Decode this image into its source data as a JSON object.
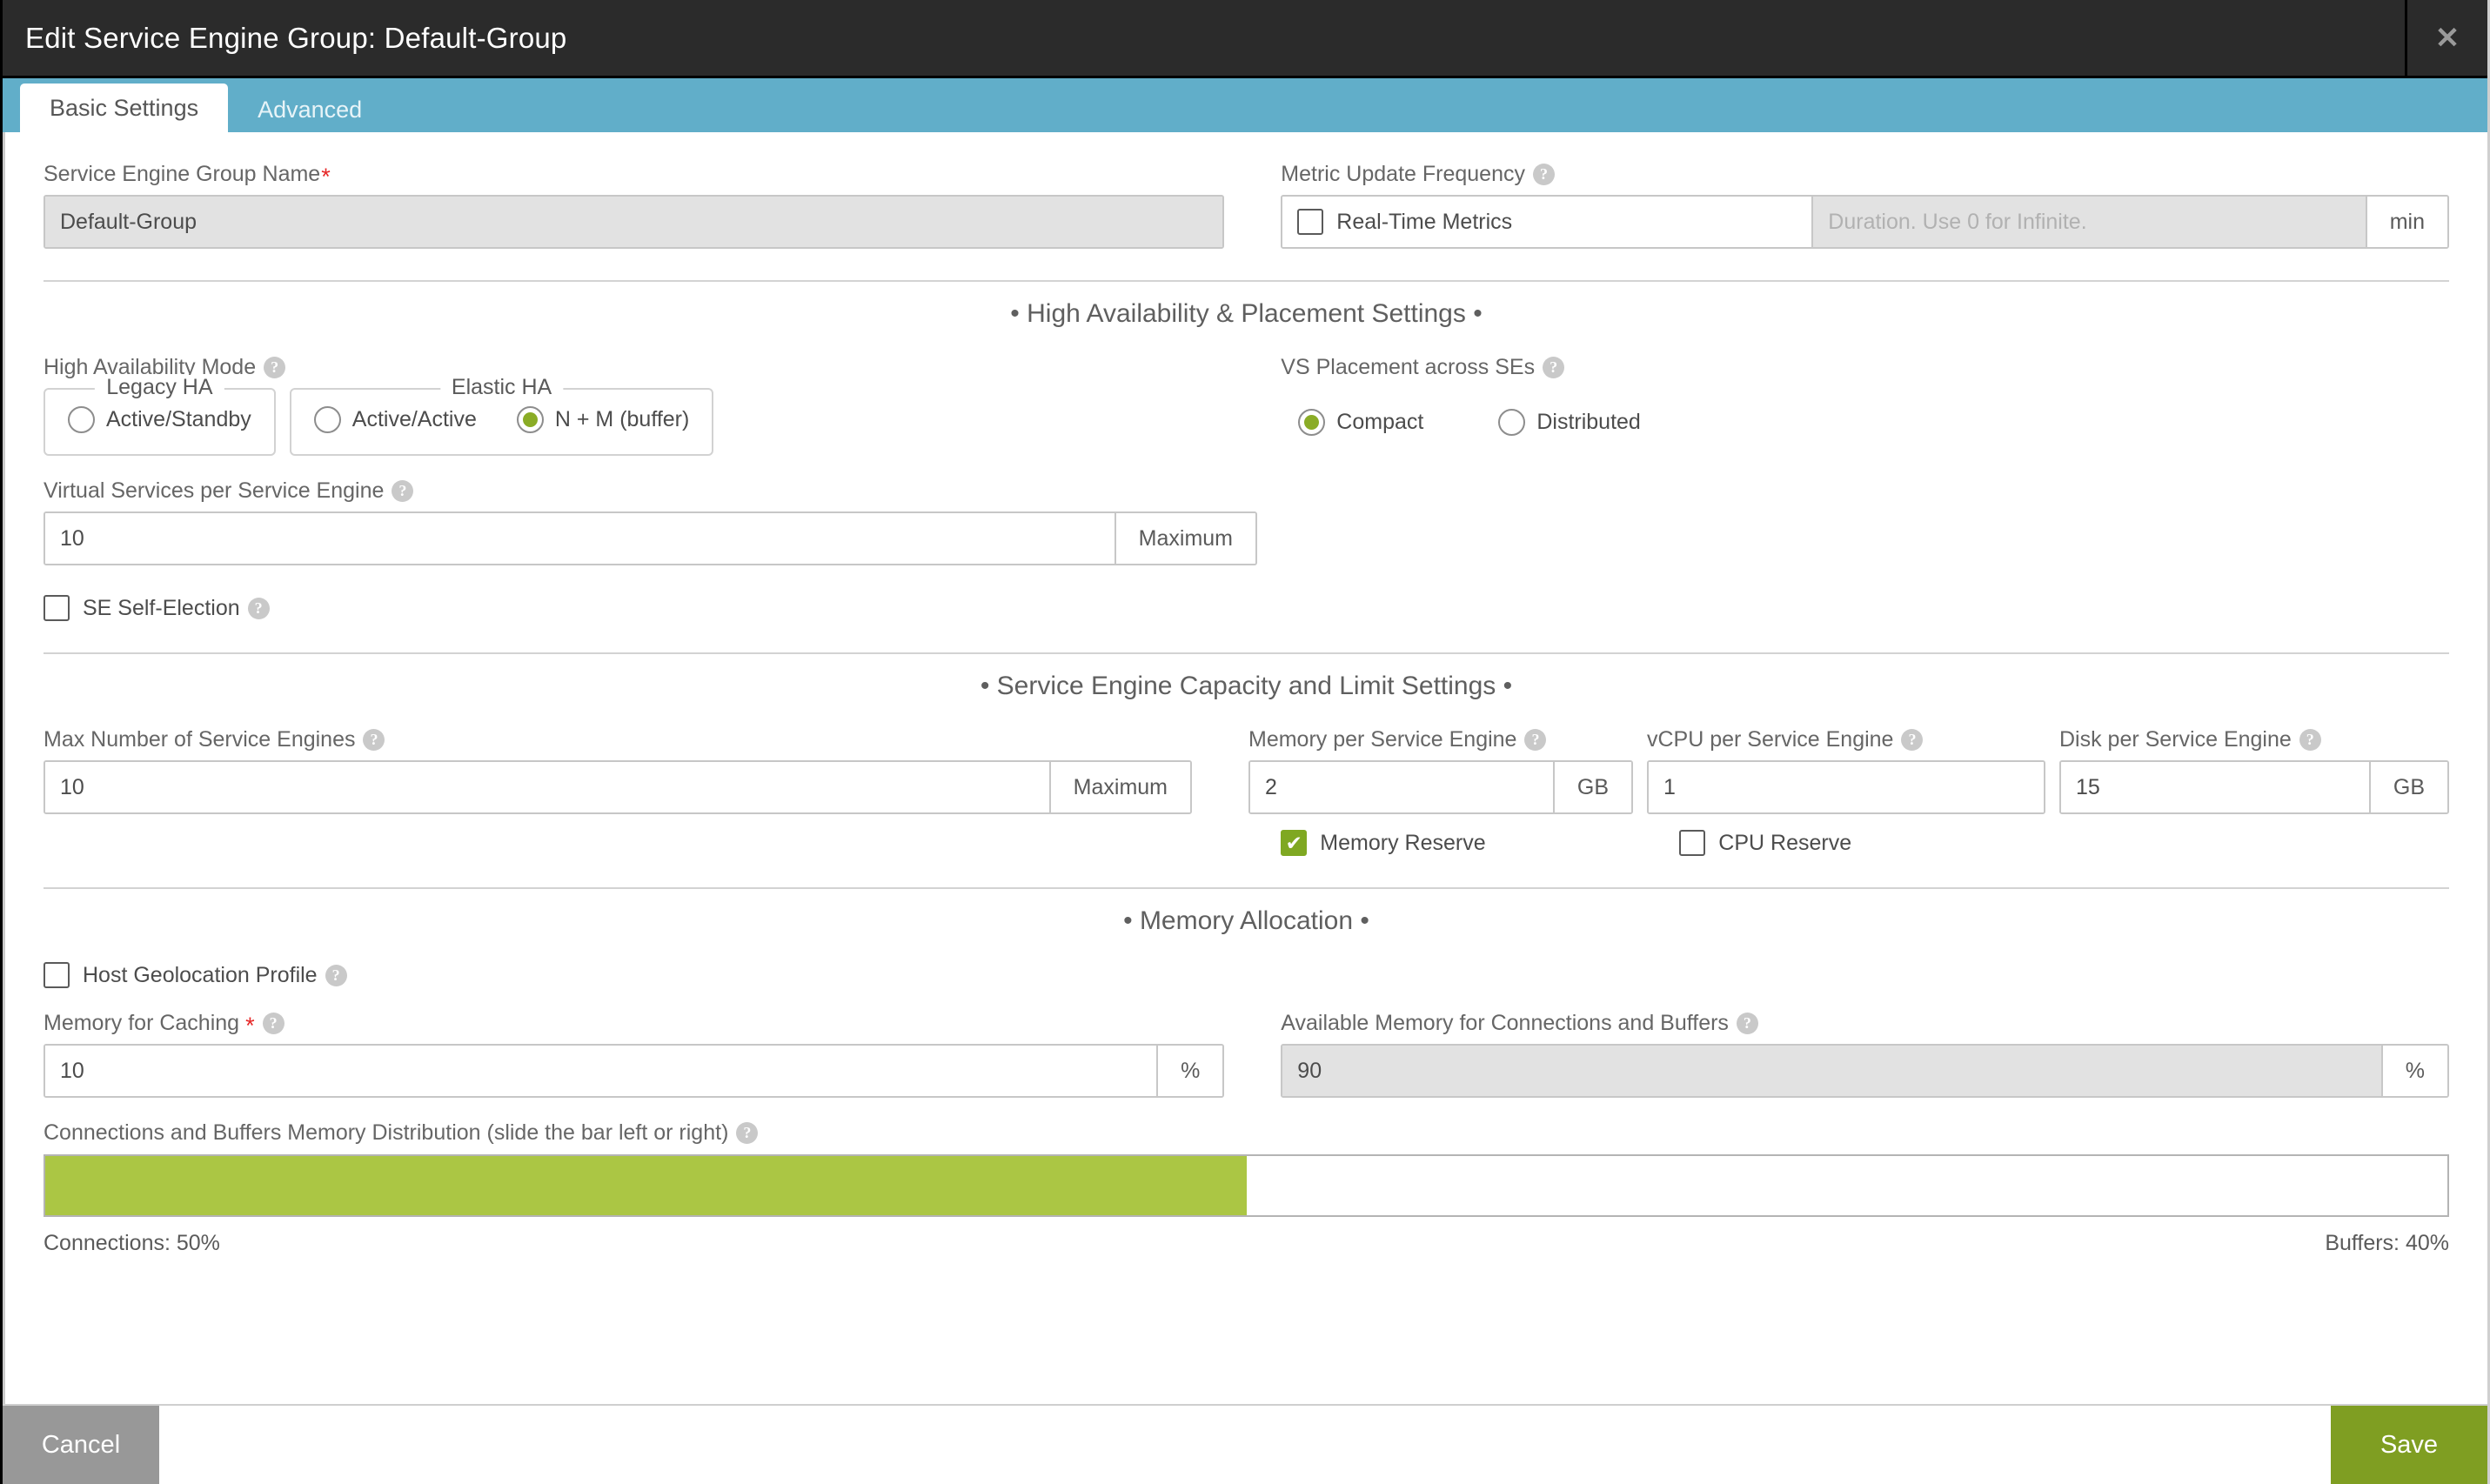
{
  "window": {
    "title": "Edit Service Engine Group: Default-Group",
    "close_icon": "close-icon"
  },
  "tabs": [
    {
      "label": "Basic Settings",
      "active": true
    },
    {
      "label": "Advanced",
      "active": false
    }
  ],
  "form": {
    "se_group_name": {
      "label": "Service Engine Group Name",
      "required": true,
      "value": "Default-Group",
      "disabled": true
    },
    "metric_update_frequency": {
      "label": "Metric Update Frequency",
      "help": "?",
      "realtime_checkbox_label": "Real-Time Metrics",
      "realtime_checked": false,
      "duration_placeholder": "Duration. Use 0 for Infinite.",
      "duration_value": "",
      "unit": "min"
    },
    "sections": {
      "ha_placement": "High Availability & Placement Settings",
      "capacity": "Service Engine Capacity and Limit Settings",
      "memory": "Memory Allocation"
    },
    "high_availability_mode": {
      "label": "High Availability Mode",
      "help": "?",
      "groups": [
        {
          "legend": "Legacy HA",
          "options": [
            {
              "label": "Active/Standby",
              "selected": false
            }
          ]
        },
        {
          "legend": "Elastic HA",
          "options": [
            {
              "label": "Active/Active",
              "selected": false
            },
            {
              "label": "N + M (buffer)",
              "selected": true
            }
          ]
        }
      ]
    },
    "vs_placement": {
      "label": "VS Placement across SEs",
      "help": "?",
      "options": [
        {
          "label": "Compact",
          "selected": true
        },
        {
          "label": "Distributed",
          "selected": false
        }
      ]
    },
    "virtual_services_per_se": {
      "label": "Virtual Services per Service Engine",
      "help": "?",
      "value": "10",
      "suffix": "Maximum"
    },
    "se_self_election": {
      "label": "SE Self-Election",
      "help": "?",
      "checked": false
    },
    "max_number_of_ses": {
      "label": "Max Number of Service Engines",
      "help": "?",
      "value": "10",
      "suffix": "Maximum"
    },
    "memory_per_se": {
      "label": "Memory per Service Engine",
      "help": "?",
      "value": "2",
      "suffix": "GB"
    },
    "vcpu_per_se": {
      "label": "vCPU per Service Engine",
      "help": "?",
      "value": "1",
      "suffix": ""
    },
    "disk_per_se": {
      "label": "Disk per Service Engine",
      "help": "?",
      "value": "15",
      "suffix": "GB"
    },
    "memory_reserve": {
      "label": "Memory Reserve",
      "checked": true
    },
    "cpu_reserve": {
      "label": "CPU Reserve",
      "checked": false
    },
    "host_geolocation_profile": {
      "label": "Host Geolocation Profile",
      "help": "?",
      "checked": false
    },
    "memory_for_caching": {
      "label": "Memory for Caching",
      "required": true,
      "help": "?",
      "value": "10",
      "suffix": "%"
    },
    "available_memory": {
      "label": "Available Memory for Connections and Buffers",
      "help": "?",
      "value": "90",
      "suffix": "%",
      "disabled": true
    },
    "memory_distribution": {
      "label": "Connections and Buffers Memory Distribution (slide the bar left or right)",
      "help": "?",
      "fill_percent": 50,
      "left_legend": "Connections: 50%",
      "right_legend": "Buffers: 40%"
    }
  },
  "footer": {
    "cancel_label": "Cancel",
    "save_label": "Save"
  },
  "colors": {
    "titlebar_bg": "#2b2b2b",
    "tabbar_bg": "#61aec9",
    "accent_green": "#7f9e22",
    "slider_green": "#abc644",
    "cancel_gray": "#989898",
    "required_red": "#e62828"
  }
}
